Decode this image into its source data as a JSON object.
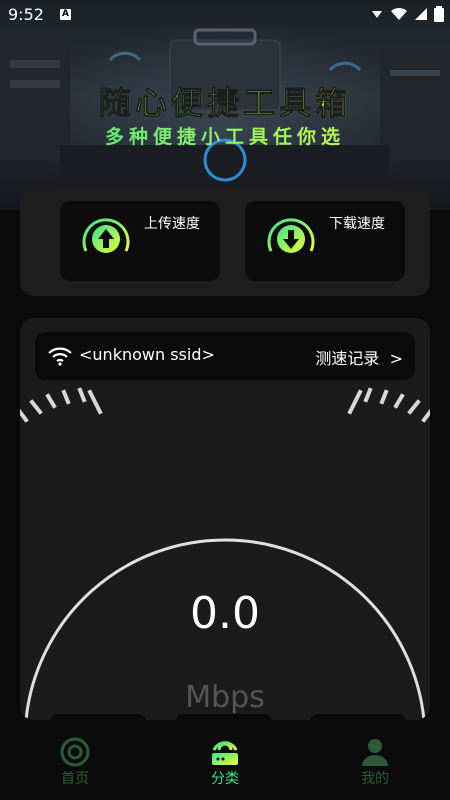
{
  "status": {
    "time": "9:52",
    "indicator": "A"
  },
  "hero": {
    "title": "随心便捷工具箱",
    "subtitle": "多种便捷小工具任你选"
  },
  "speed_test": {
    "upload_label": "上传速度",
    "download_label": "下载速度"
  },
  "network": {
    "ssid": "<unknown ssid>",
    "record_label": "测速记录",
    "record_arrow": ">"
  },
  "gauge": {
    "value": "0.0",
    "unit": "Mbps"
  },
  "nav": {
    "items": [
      {
        "label": "首页",
        "icon": "home-icon",
        "active": false
      },
      {
        "label": "分类",
        "icon": "category-icon",
        "active": true
      },
      {
        "label": "我的",
        "icon": "profile-icon",
        "active": false
      }
    ]
  },
  "colors": {
    "accent_green": "#3be38a",
    "accent_yellow": "#e9ff3c",
    "nav_inactive": "#2f5a38"
  }
}
